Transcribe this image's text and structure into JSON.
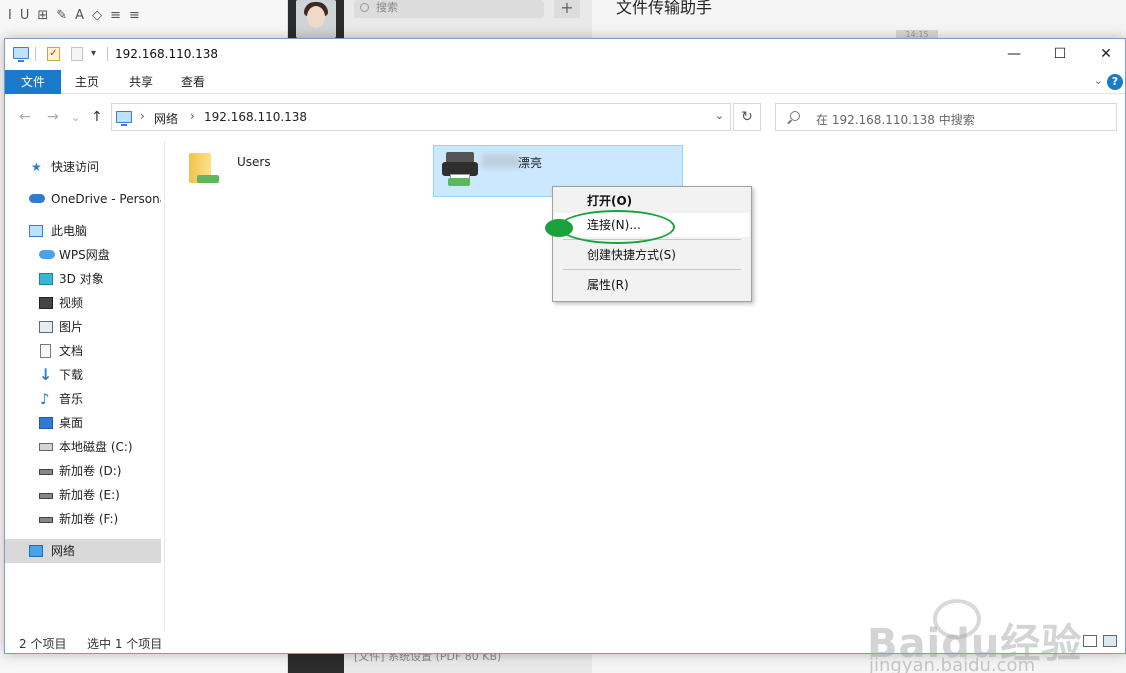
{
  "background": {
    "toolbar_glyphs": [
      "I",
      "U",
      "⊞",
      "✎",
      "A",
      "◇",
      "≡",
      "≡"
    ],
    "search_placeholder": "搜索",
    "plus_label": "+",
    "chat_title": "文件传输助手",
    "time_label": "14:15",
    "bottom_snippet": "[文件] 系统设置 (PDF 80 KB)"
  },
  "window": {
    "title": "192.168.110.138",
    "controls": {
      "minimize": "—",
      "maximize": "☐",
      "close": "✕"
    },
    "ribbon_tabs": [
      "文件",
      "主页",
      "共享",
      "查看"
    ],
    "help_label": "?",
    "ribbon_chevron": "⌄"
  },
  "nav": {
    "back": "←",
    "forward": "→",
    "recent": "⌄",
    "up": "↑",
    "address": [
      "网络",
      "192.168.110.138"
    ],
    "address_sep": "›",
    "dropdown": "⌄",
    "refresh": "↻",
    "search_placeholder": "在 192.168.110.138 中搜索"
  },
  "sidebar": {
    "items": [
      {
        "label": "快速访问",
        "icon": "star-icon"
      },
      {
        "label": "OneDrive - Persona",
        "icon": "cloud-icon"
      },
      {
        "label": "此电脑",
        "icon": "computer-icon"
      },
      {
        "label": "WPS网盘",
        "icon": "cloud-drive-icon"
      },
      {
        "label": "3D 对象",
        "icon": "cube-icon"
      },
      {
        "label": "视频",
        "icon": "film-icon"
      },
      {
        "label": "图片",
        "icon": "picture-icon"
      },
      {
        "label": "文档",
        "icon": "document-icon"
      },
      {
        "label": "下载",
        "icon": "download-icon"
      },
      {
        "label": "音乐",
        "icon": "music-icon"
      },
      {
        "label": "桌面",
        "icon": "desktop-icon"
      },
      {
        "label": "本地磁盘 (C:)",
        "icon": "drive-icon"
      },
      {
        "label": "新加卷 (D:)",
        "icon": "drive-icon"
      },
      {
        "label": "新加卷 (E:)",
        "icon": "drive-icon"
      },
      {
        "label": "新加卷 (F:)",
        "icon": "drive-icon"
      },
      {
        "label": "网络",
        "icon": "network-icon"
      }
    ]
  },
  "content": {
    "items": [
      {
        "name": "Users",
        "icon": "shared-folder-icon"
      },
      {
        "name": "漂亮",
        "icon": "network-printer-icon"
      }
    ]
  },
  "context_menu": {
    "items": [
      {
        "label": "打开(O)",
        "bold": true
      },
      {
        "label": "连接(N)..."
      },
      {
        "label": "创建快捷方式(S)"
      },
      {
        "label": "属性(R)"
      }
    ]
  },
  "status": {
    "count": "2 个项目",
    "selection": "选中 1 个项目"
  },
  "watermark": {
    "brand": "Baidu经验",
    "url": "jingyan.baidu.com"
  },
  "colors": {
    "accent": "#1979ca",
    "selection": "#cce8ff",
    "annotation": "#19a33a"
  }
}
